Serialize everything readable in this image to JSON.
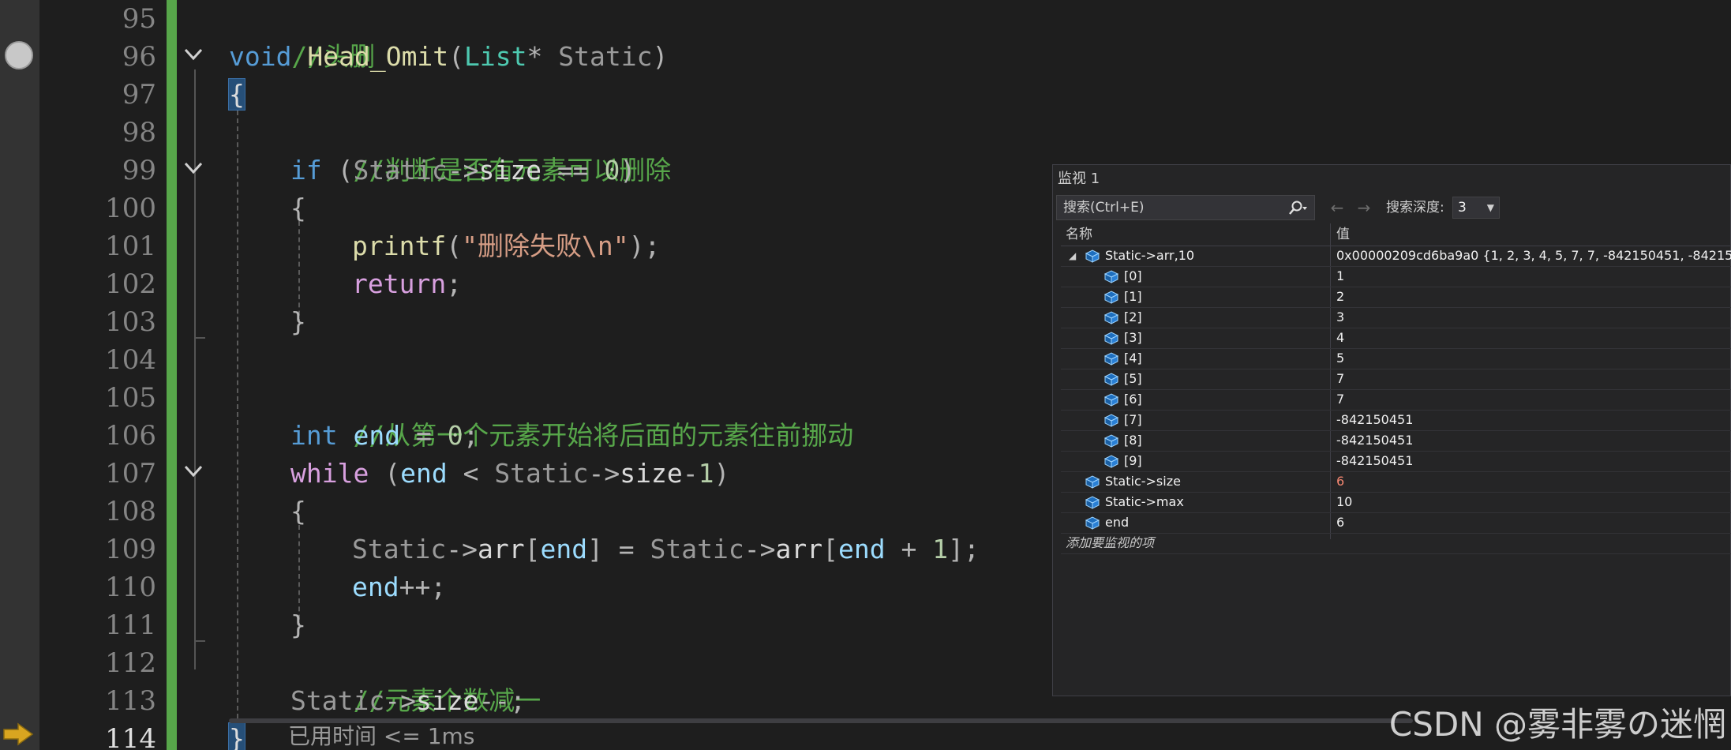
{
  "editor": {
    "lines": [
      {
        "number": "95"
      },
      {
        "number": "96"
      },
      {
        "number": "97"
      },
      {
        "number": "98"
      },
      {
        "number": "99"
      },
      {
        "number": "100"
      },
      {
        "number": "101"
      },
      {
        "number": "102"
      },
      {
        "number": "103"
      },
      {
        "number": "104"
      },
      {
        "number": "105"
      },
      {
        "number": "106"
      },
      {
        "number": "107"
      },
      {
        "number": "108"
      },
      {
        "number": "109"
      },
      {
        "number": "110"
      },
      {
        "number": "111"
      },
      {
        "number": "112"
      },
      {
        "number": "113"
      },
      {
        "number": "114"
      }
    ],
    "code": {
      "l95": "//头删",
      "l96_kw": "void",
      "l96_fn": "Head_Omit",
      "l96_type": "List",
      "l96_param": "Static",
      "l98": "//判断是否有元素可以删除",
      "l99_kw": "if",
      "l99_param": "Static",
      "l99_member": "size",
      "l99_num": "0",
      "l101_fn": "printf",
      "l101_str": "\"删除失败\\n\"",
      "l102_kw": "return",
      "l105": "//从第一个元素开始将后面的元素往前挪动",
      "l106_kw": "int",
      "l106_var": "end",
      "l106_num": "0",
      "l107_kw": "while",
      "l107_var": "end",
      "l107_param": "Static",
      "l107_member": "size",
      "l107_num": "1",
      "l109_param_a": "Static",
      "l109_member_a": "arr",
      "l109_var_a": "end",
      "l109_param_b": "Static",
      "l109_member_b": "arr",
      "l109_var_b": "end",
      "l109_num": "1",
      "l110_var": "end",
      "l112": "//元素个数减一",
      "l113_param": "Static",
      "l113_member": "size"
    },
    "elapsed_label": "已用时间 <= 1ms",
    "breakpoint_line": "96",
    "current_line": "114"
  },
  "watch_window": {
    "title": "监视 1",
    "search_placeholder": "搜索(Ctrl+E)",
    "search_depth_label": "搜索深度:",
    "search_depth_value": "3",
    "columns": {
      "name": "名称",
      "value": "值"
    },
    "rows": [
      {
        "name": "Static->arr,10",
        "value": "0x00000209cd6ba9a0 {1, 2, 3, 4, 5, 7, 7, -842150451, -842150...",
        "expanded": true,
        "level": 0
      },
      {
        "name": "[0]",
        "value": "1",
        "level": 1
      },
      {
        "name": "[1]",
        "value": "2",
        "level": 1
      },
      {
        "name": "[2]",
        "value": "3",
        "level": 1
      },
      {
        "name": "[3]",
        "value": "4",
        "level": 1
      },
      {
        "name": "[4]",
        "value": "5",
        "level": 1
      },
      {
        "name": "[5]",
        "value": "7",
        "level": 1
      },
      {
        "name": "[6]",
        "value": "7",
        "level": 1
      },
      {
        "name": "[7]",
        "value": "-842150451",
        "level": 1
      },
      {
        "name": "[8]",
        "value": "-842150451",
        "level": 1
      },
      {
        "name": "[9]",
        "value": "-842150451",
        "level": 1
      },
      {
        "name": "Static->size",
        "value": "6",
        "level": 0,
        "changed": true
      },
      {
        "name": "Static->max",
        "value": "10",
        "level": 0
      },
      {
        "name": "end",
        "value": "6",
        "level": 0
      }
    ],
    "add_item_label": "添加要监视的项"
  },
  "watermark": "CSDN @雾非雾の迷惘",
  "colors": {
    "background": "#1e1e1e",
    "change_bar": "#57a64a",
    "comment": "#57a64a",
    "keyword": "#569cd6",
    "control": "#d8a0df",
    "type": "#4ec9b0",
    "function": "#dcdcaa",
    "string": "#d69d85",
    "changed_value": "#f48771"
  }
}
